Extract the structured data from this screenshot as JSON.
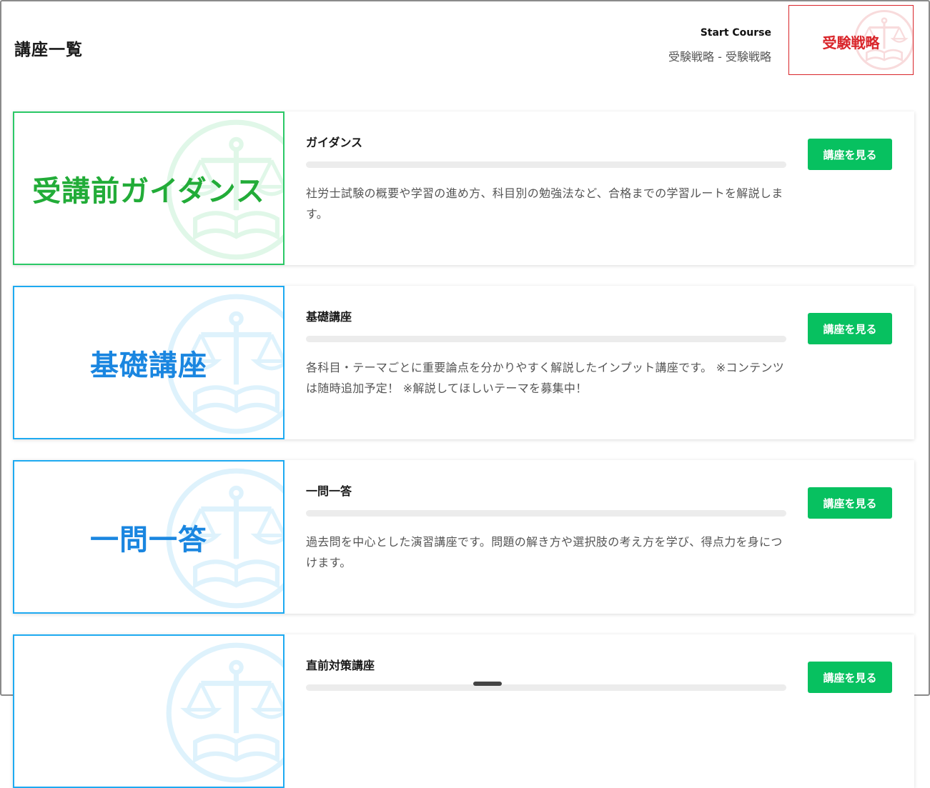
{
  "page": {
    "title": "講座一覧"
  },
  "header": {
    "start_title": "Start Course",
    "start_subtitle": "受験戦略 - 受験戦略",
    "thumb_label": "受験戦略",
    "accent_color": "#d9252a"
  },
  "colors": {
    "button": "#07c160",
    "green_thumb_border": "#2bc866",
    "blue_thumb_border": "#1eaaf1",
    "green_text": "#22ac38",
    "blue_text": "#1a86e0"
  },
  "icons": {
    "watermark": "scales-book-icon"
  },
  "courses": [
    {
      "thumb_text": "受講前ガイダンス",
      "theme": "green",
      "title": "ガイダンス",
      "progress": 0,
      "description": "社労士試験の概要や学習の進め方、科目別の勉強法など、合格までの学習ルートを解説します。",
      "button_label": "講座を見る"
    },
    {
      "thumb_text": "基礎講座",
      "theme": "blue",
      "title": "基礎講座",
      "progress": 0,
      "description": "各科目・テーマごとに重要論点を分かりやすく解説したインプット講座です。 ※コンテンツは随時追加予定！ ※解説してほしいテーマを募集中！",
      "button_label": "講座を見る"
    },
    {
      "thumb_text": "一問一答",
      "theme": "blue",
      "title": "一問一答",
      "progress": 0,
      "description": "過去問を中心とした演習講座です。問題の解き方や選択肢の考え方を学び、得点力を身につけます。",
      "button_label": "講座を見る"
    },
    {
      "thumb_text": "",
      "theme": "blue",
      "title": "直前対策講座",
      "progress": 0,
      "description": "",
      "button_label": "講座を見る"
    }
  ]
}
